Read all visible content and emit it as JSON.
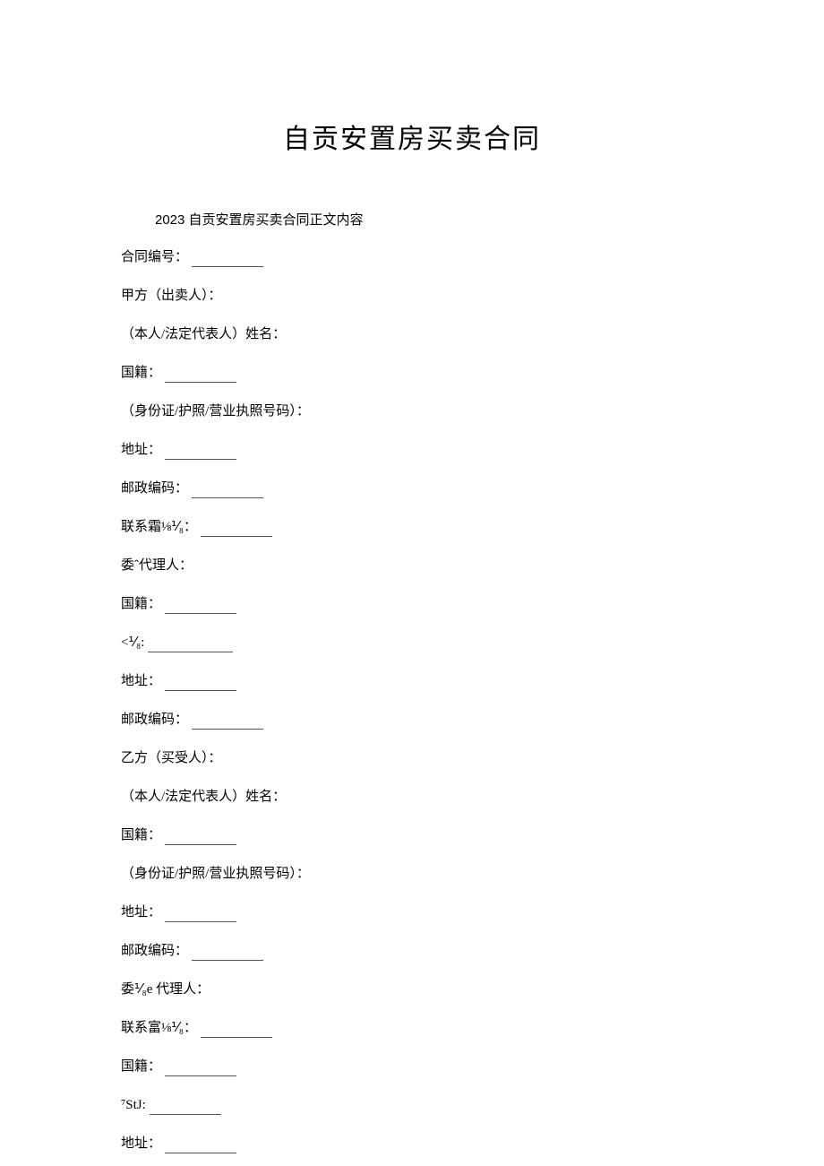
{
  "title": "自贡安置房买卖合同",
  "subtitle": "2023 自贡安置房买卖合同正文内容",
  "lines": {
    "contract_no": "合同编号：",
    "party_a": "甲方（出卖人）：",
    "name_a": "（本人/法定代表人）姓名：",
    "nationality_a": "国籍：",
    "id_a": "（身份证/护照/营业执照号码）：",
    "address_a": "地址：",
    "postal_a": "邮政编码：",
    "contact_a": "联系霜⅛⅟₈：",
    "agent_a": "委ˆ代理人：",
    "nationality_a2": "国籍：",
    "misc1": "<⅟₈:",
    "address_a2": "地址：",
    "postal_a2": "邮政编码：",
    "party_b": "乙方（买受人）：",
    "name_b": "（本人/法定代表人）姓名：",
    "nationality_b": "国籍：",
    "id_b": "（身份证/护照/营业执照号码）：",
    "address_b": "地址：",
    "postal_b": "邮政编码：",
    "agent_b": "委⅟₈e 代理人：",
    "contact_b": "联系富⅛⅟₈：",
    "nationality_b2": "国籍：",
    "misc2": "⁷StJ:",
    "address_b2": "地址："
  }
}
